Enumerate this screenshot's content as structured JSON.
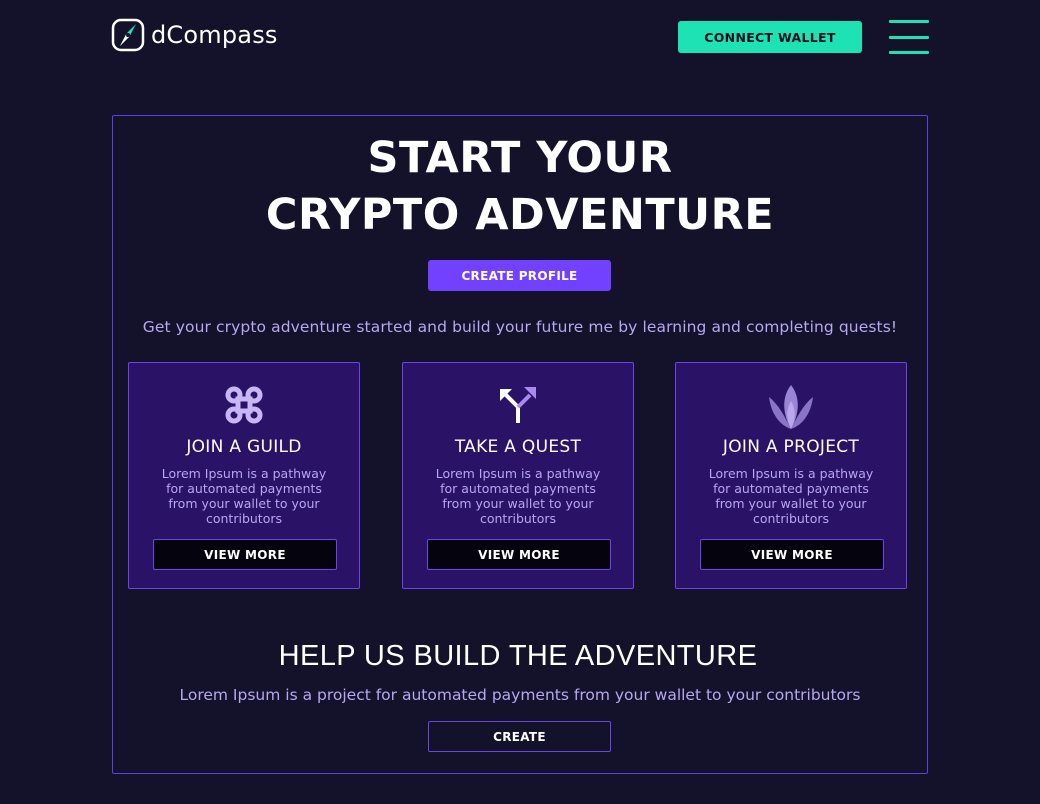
{
  "header": {
    "brand": "dCompass",
    "connect_label": "CONNECT WALLET",
    "menu_icon": "hamburger-menu-icon"
  },
  "hero": {
    "title_line1": "START YOUR",
    "title_line2": "CRYPTO ADVENTURE",
    "create_profile_label": "CREATE PROFILE",
    "subtitle": "Get your crypto adventure started and build your future me by learning and completing quests!"
  },
  "cards": [
    {
      "icon": "guild-icon",
      "title": "JOIN A GUILD",
      "description": "Lorem Ipsum is a pathway for automated payments from your wallet to your contributors",
      "button_label": "VIEW MORE"
    },
    {
      "icon": "quest-arrow-icon",
      "title": "TAKE A QUEST",
      "description": "Lorem Ipsum is a pathway for automated payments from your wallet to your contributors",
      "button_label": "VIEW MORE"
    },
    {
      "icon": "lotus-icon",
      "title": "JOIN A PROJECT",
      "description": "Lorem Ipsum is a pathway for automated payments from your wallet to your contributors",
      "button_label": "VIEW MORE"
    }
  ],
  "help": {
    "title": "HELP US BUILD THE ADVENTURE",
    "subtitle": "Lorem Ipsum is a project for automated payments from your wallet to your contributors",
    "create_label": "CREATE"
  },
  "colors": {
    "background": "#14122b",
    "accent_teal": "#1de2b3",
    "accent_purple": "#7141ff",
    "card_bg": "#2a1366",
    "border": "#6a45e8",
    "muted_text": "#b7a6f0"
  }
}
